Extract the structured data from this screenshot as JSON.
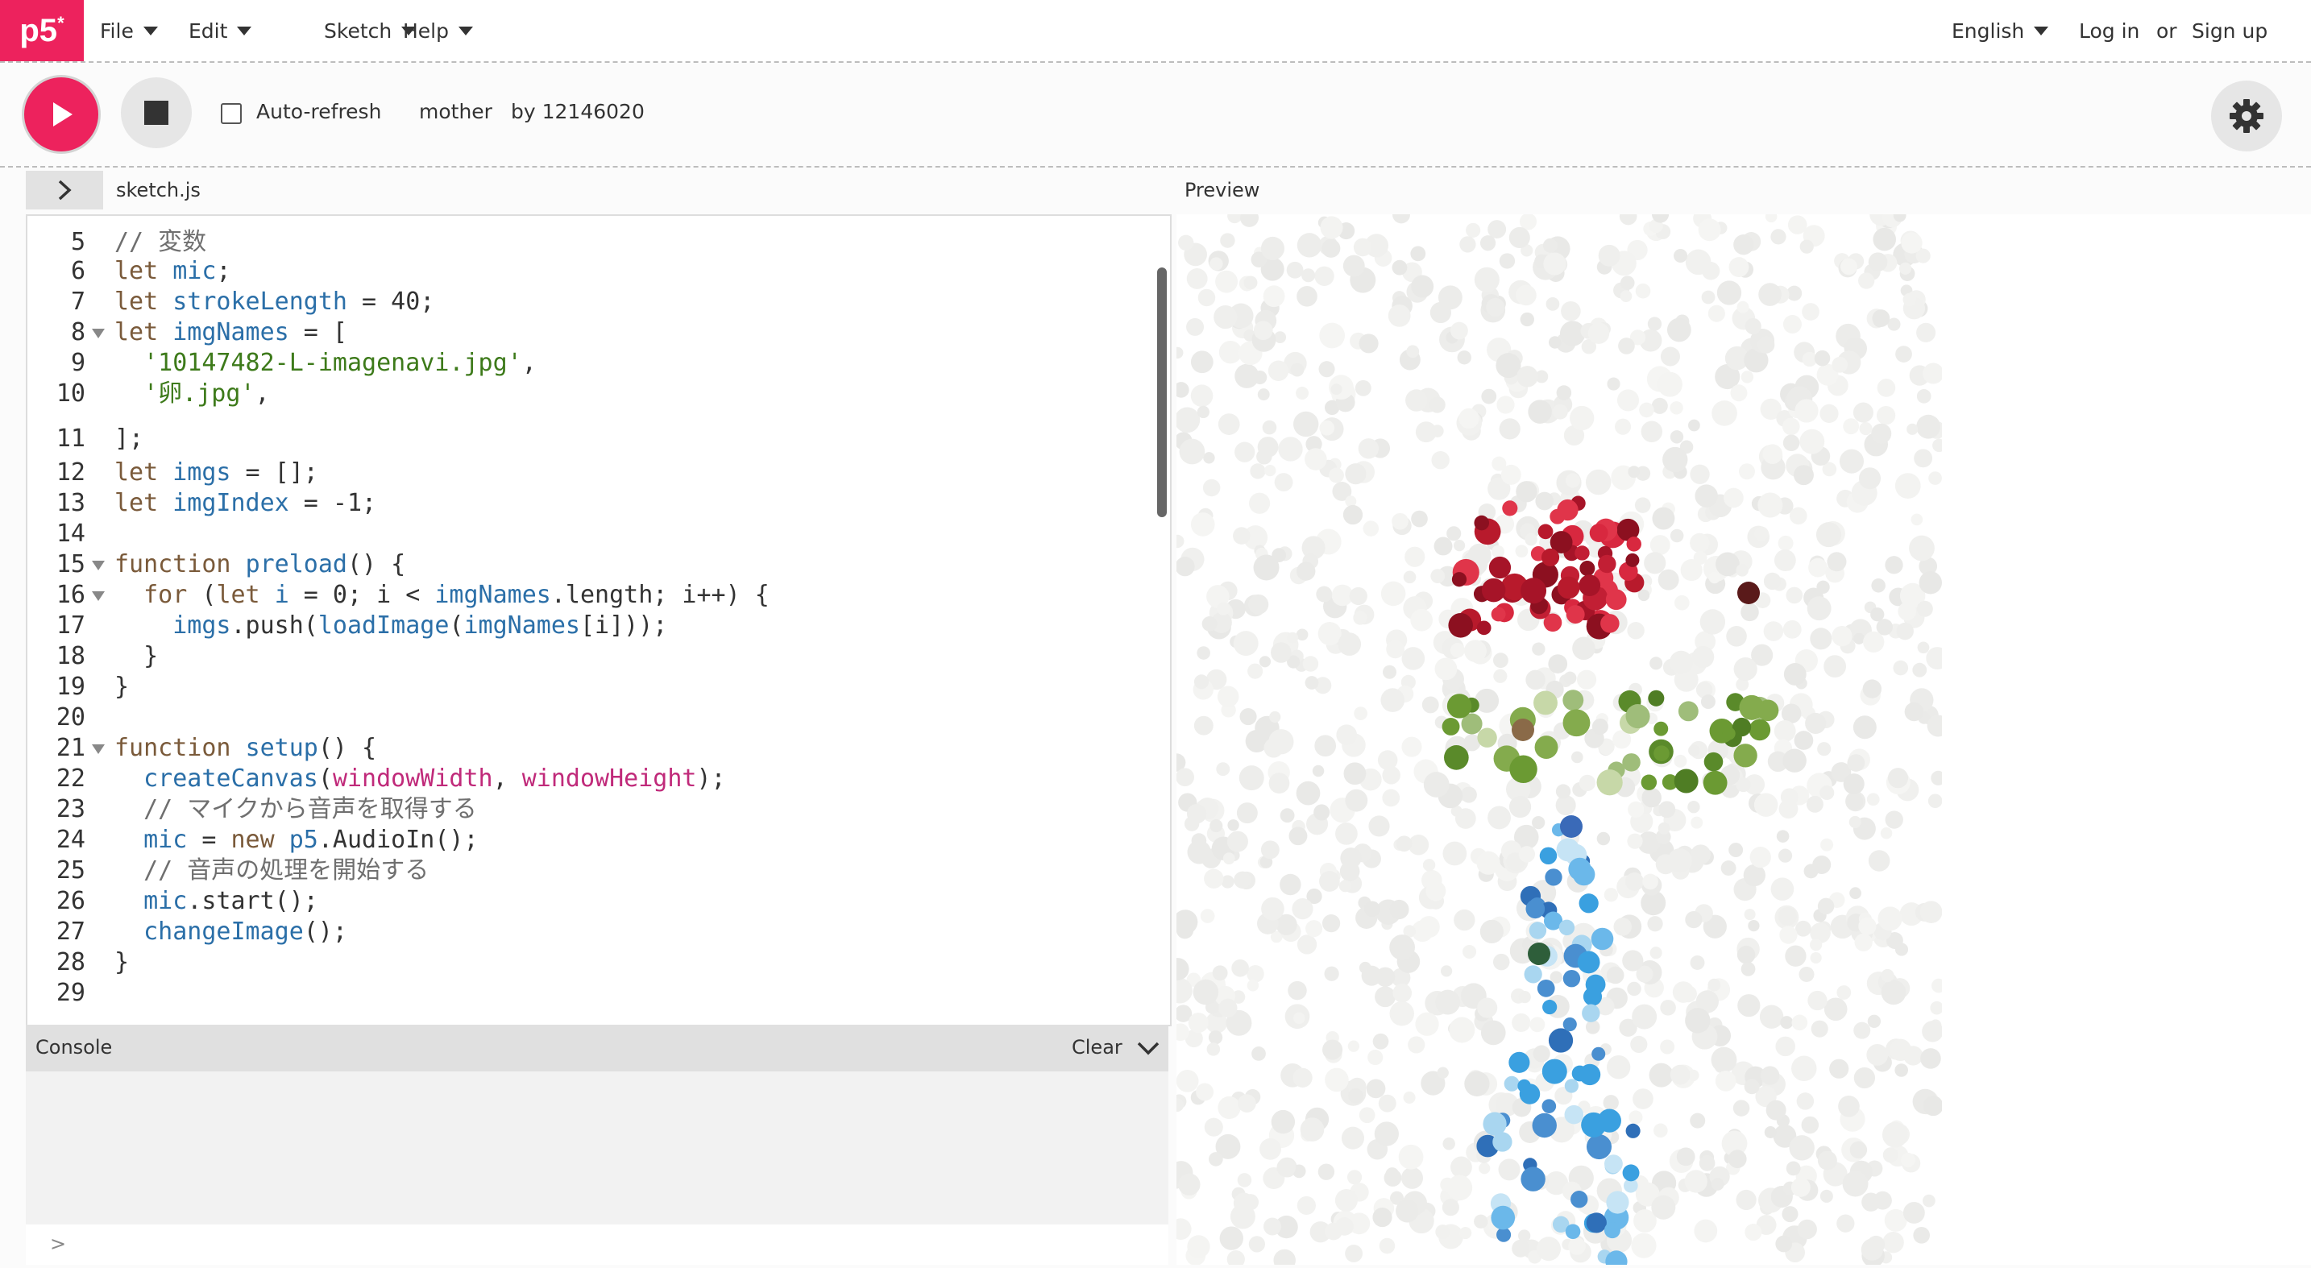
{
  "nav": {
    "logo": "p5",
    "logo_sup": "*",
    "menu": [
      "File",
      "Edit",
      "Sketch",
      "Help"
    ],
    "language": "English",
    "login": "Log in",
    "or": "or",
    "signup": "Sign up"
  },
  "toolbar": {
    "auto_refresh": "Auto-refresh",
    "sketch_name": "mother",
    "author": "by 12146020"
  },
  "editor": {
    "file_tab": "sketch.js",
    "lines": [
      {
        "n": "5",
        "fold": false,
        "tokens": [
          {
            "t": "c",
            "s": "// 変数"
          }
        ]
      },
      {
        "n": "6",
        "fold": false,
        "tokens": [
          {
            "t": "k",
            "s": "let "
          },
          {
            "t": "v",
            "s": "mic"
          },
          {
            "t": "p",
            "s": ";"
          }
        ]
      },
      {
        "n": "7",
        "fold": false,
        "tokens": [
          {
            "t": "k",
            "s": "let "
          },
          {
            "t": "v",
            "s": "strokeLength"
          },
          {
            "t": "p",
            "s": " = 40;"
          }
        ]
      },
      {
        "n": "8",
        "fold": true,
        "tokens": [
          {
            "t": "k",
            "s": "let "
          },
          {
            "t": "v",
            "s": "imgNames"
          },
          {
            "t": "p",
            "s": " = ["
          }
        ]
      },
      {
        "n": "9",
        "fold": false,
        "tokens": [
          {
            "t": "p",
            "s": "  "
          },
          {
            "t": "s",
            "s": "'10147482-L-imagenavi.jpg'"
          },
          {
            "t": "p",
            "s": ","
          }
        ]
      },
      {
        "n": "10",
        "fold": false,
        "tokens": [
          {
            "t": "p",
            "s": "  "
          },
          {
            "t": "s",
            "s": "'卵.jpg'"
          },
          {
            "t": "p",
            "s": ","
          }
        ]
      },
      {
        "n": "11",
        "fold": false,
        "tokens": [
          {
            "t": "p",
            "s": "];"
          }
        ]
      },
      {
        "n": "12",
        "fold": false,
        "tokens": [
          {
            "t": "k",
            "s": "let "
          },
          {
            "t": "v",
            "s": "imgs"
          },
          {
            "t": "p",
            "s": " = [];"
          }
        ]
      },
      {
        "n": "13",
        "fold": false,
        "tokens": [
          {
            "t": "k",
            "s": "let "
          },
          {
            "t": "v",
            "s": "imgIndex"
          },
          {
            "t": "p",
            "s": " = -1;"
          }
        ]
      },
      {
        "n": "14",
        "fold": false,
        "tokens": []
      },
      {
        "n": "15",
        "fold": true,
        "tokens": [
          {
            "t": "k",
            "s": "function "
          },
          {
            "t": "f",
            "s": "preload"
          },
          {
            "t": "p",
            "s": "() {"
          }
        ]
      },
      {
        "n": "16",
        "fold": true,
        "tokens": [
          {
            "t": "p",
            "s": "  "
          },
          {
            "t": "k",
            "s": "for"
          },
          {
            "t": "p",
            "s": " ("
          },
          {
            "t": "k",
            "s": "let "
          },
          {
            "t": "v",
            "s": "i"
          },
          {
            "t": "p",
            "s": " = 0; i < "
          },
          {
            "t": "v",
            "s": "imgNames"
          },
          {
            "t": "p",
            "s": ".length; i++) {"
          }
        ]
      },
      {
        "n": "17",
        "fold": false,
        "tokens": [
          {
            "t": "p",
            "s": "    "
          },
          {
            "t": "v",
            "s": "imgs"
          },
          {
            "t": "p",
            "s": ".push("
          },
          {
            "t": "f",
            "s": "loadImage"
          },
          {
            "t": "p",
            "s": "("
          },
          {
            "t": "v",
            "s": "imgNames"
          },
          {
            "t": "p",
            "s": "[i]));"
          }
        ]
      },
      {
        "n": "18",
        "fold": false,
        "tokens": [
          {
            "t": "p",
            "s": "  }"
          }
        ]
      },
      {
        "n": "19",
        "fold": false,
        "tokens": [
          {
            "t": "p",
            "s": "}"
          }
        ]
      },
      {
        "n": "20",
        "fold": false,
        "tokens": []
      },
      {
        "n": "21",
        "fold": true,
        "tokens": [
          {
            "t": "k",
            "s": "function "
          },
          {
            "t": "f",
            "s": "setup"
          },
          {
            "t": "p",
            "s": "() {"
          }
        ]
      },
      {
        "n": "22",
        "fold": false,
        "tokens": [
          {
            "t": "p",
            "s": "  "
          },
          {
            "t": "f",
            "s": "createCanvas"
          },
          {
            "t": "p",
            "s": "("
          },
          {
            "t": "b",
            "s": "windowWidth"
          },
          {
            "t": "p",
            "s": ", "
          },
          {
            "t": "b",
            "s": "windowHeight"
          },
          {
            "t": "p",
            "s": ");"
          }
        ]
      },
      {
        "n": "23",
        "fold": false,
        "tokens": [
          {
            "t": "p",
            "s": "  "
          },
          {
            "t": "c",
            "s": "// マイクから音声を取得する"
          }
        ]
      },
      {
        "n": "24",
        "fold": false,
        "tokens": [
          {
            "t": "p",
            "s": "  "
          },
          {
            "t": "v",
            "s": "mic"
          },
          {
            "t": "p",
            "s": " = "
          },
          {
            "t": "k",
            "s": "new "
          },
          {
            "t": "v",
            "s": "p5"
          },
          {
            "t": "p",
            "s": ".AudioIn();"
          }
        ]
      },
      {
        "n": "25",
        "fold": false,
        "tokens": [
          {
            "t": "p",
            "s": "  "
          },
          {
            "t": "c",
            "s": "// 音声の処理を開始する"
          }
        ]
      },
      {
        "n": "26",
        "fold": false,
        "tokens": [
          {
            "t": "p",
            "s": "  "
          },
          {
            "t": "v",
            "s": "mic"
          },
          {
            "t": "p",
            "s": ".start();"
          }
        ]
      },
      {
        "n": "27",
        "fold": false,
        "tokens": [
          {
            "t": "p",
            "s": "  "
          },
          {
            "t": "f",
            "s": "changeImage"
          },
          {
            "t": "p",
            "s": "();"
          }
        ]
      },
      {
        "n": "28",
        "fold": false,
        "tokens": [
          {
            "t": "p",
            "s": "}"
          }
        ]
      },
      {
        "n": "29",
        "fold": false,
        "tokens": []
      }
    ]
  },
  "console": {
    "title": "Console",
    "clear": "Clear",
    "prompt": ">"
  },
  "preview": {
    "label": "Preview"
  },
  "colors": {
    "brand": "#ed225d",
    "red": "#c21f34",
    "green": "#6b9a33",
    "blue": "#3aa0e0",
    "light_blue": "#a9d6f0",
    "grey_dot": "#ececec"
  }
}
